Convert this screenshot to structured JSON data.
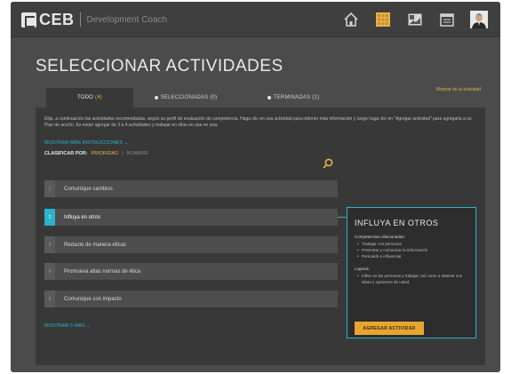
{
  "header": {
    "logo_text": "CEB",
    "subtitle": "Development Coach",
    "icons": [
      "home-icon",
      "grid-icon",
      "image-icon",
      "calendar-icon",
      "user-avatar-icon"
    ],
    "accent_color": "#e7b04a"
  },
  "page": {
    "title": "SELECCIONAR ACTIVIDADES"
  },
  "tabs": [
    {
      "label": "TODO",
      "count": "(4)"
    },
    {
      "label": "SELECCIONADAS",
      "count": "(0)"
    },
    {
      "label": "TERMINADAS",
      "count": "(1)"
    }
  ],
  "tab_right_link": "Mostrar de la actividad",
  "instructions": "Elija, a continuación las actividades recomendadas, según su perfil de evaluación de competencia. Haga clic en una actividad para obtener más información y luego haga clic en \"Agregar actividad\" para agregarla a su Plan de acción. Es mejor agregar de 3 a 4 actividades y trabajar en ellas en una en una.",
  "show_more_label": "MOSTRAR MÁS INSTRUCCIONES",
  "sort": {
    "label": "CLASIFICAR POR:",
    "option_active": "PRIORIDAD",
    "option_other": "NOMBRE"
  },
  "activities": [
    {
      "num": "1",
      "label": "Comunique cambios"
    },
    {
      "num": "2",
      "label": "Influya en otros"
    },
    {
      "num": "3",
      "label": "Redacte de manera eficaz"
    },
    {
      "num": "4",
      "label": "Promueva altas normas de ética"
    },
    {
      "num": "5",
      "label": "Comunique con impacto"
    }
  ],
  "more_activities_label": "MOSTRAR 5 MÁS",
  "detail": {
    "title": "INFLUYA EN OTROS",
    "competencies_heading": "Competencias relacionadas:",
    "competencies": [
      "Trabajar con personas",
      "Presentar y comunicar la información",
      "Persuadir e influenciar"
    ],
    "goals_heading": "Logrará:",
    "goals": [
      "Influir en las personas y trabajar, así como a obtener sus ideas y opiniones de usted"
    ],
    "add_button": "AGREGAR ACTIVIDAD"
  }
}
